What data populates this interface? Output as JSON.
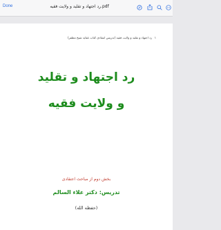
{
  "toolbar": {
    "done_label": "Done",
    "title": "رد اجتهاد و تقلید و ولایت فقیه.pdf",
    "icons": [
      "markup-icon",
      "share-icon",
      "copy-icon",
      "search-icon",
      "more-icon"
    ]
  },
  "page": {
    "header_text": "رد اجتهاد و تقلید و ولایت فقیه (تدریس انتقادی کتاب عقاید شیخ مظفر)",
    "page_number": "۱",
    "title_line1": "رد اجتهاد و تقلید",
    "title_line2": "و ولایت فقیه",
    "subtitle": "بخش دوم از مباحث اعتقادی",
    "teacher": "تدریس: دکتر علاء السالم",
    "honorific": "(حفظه الله)"
  },
  "colors": {
    "accent": "#2f6fe0",
    "title_green": "#1d8c1d",
    "subtitle_red": "#c0392b"
  }
}
